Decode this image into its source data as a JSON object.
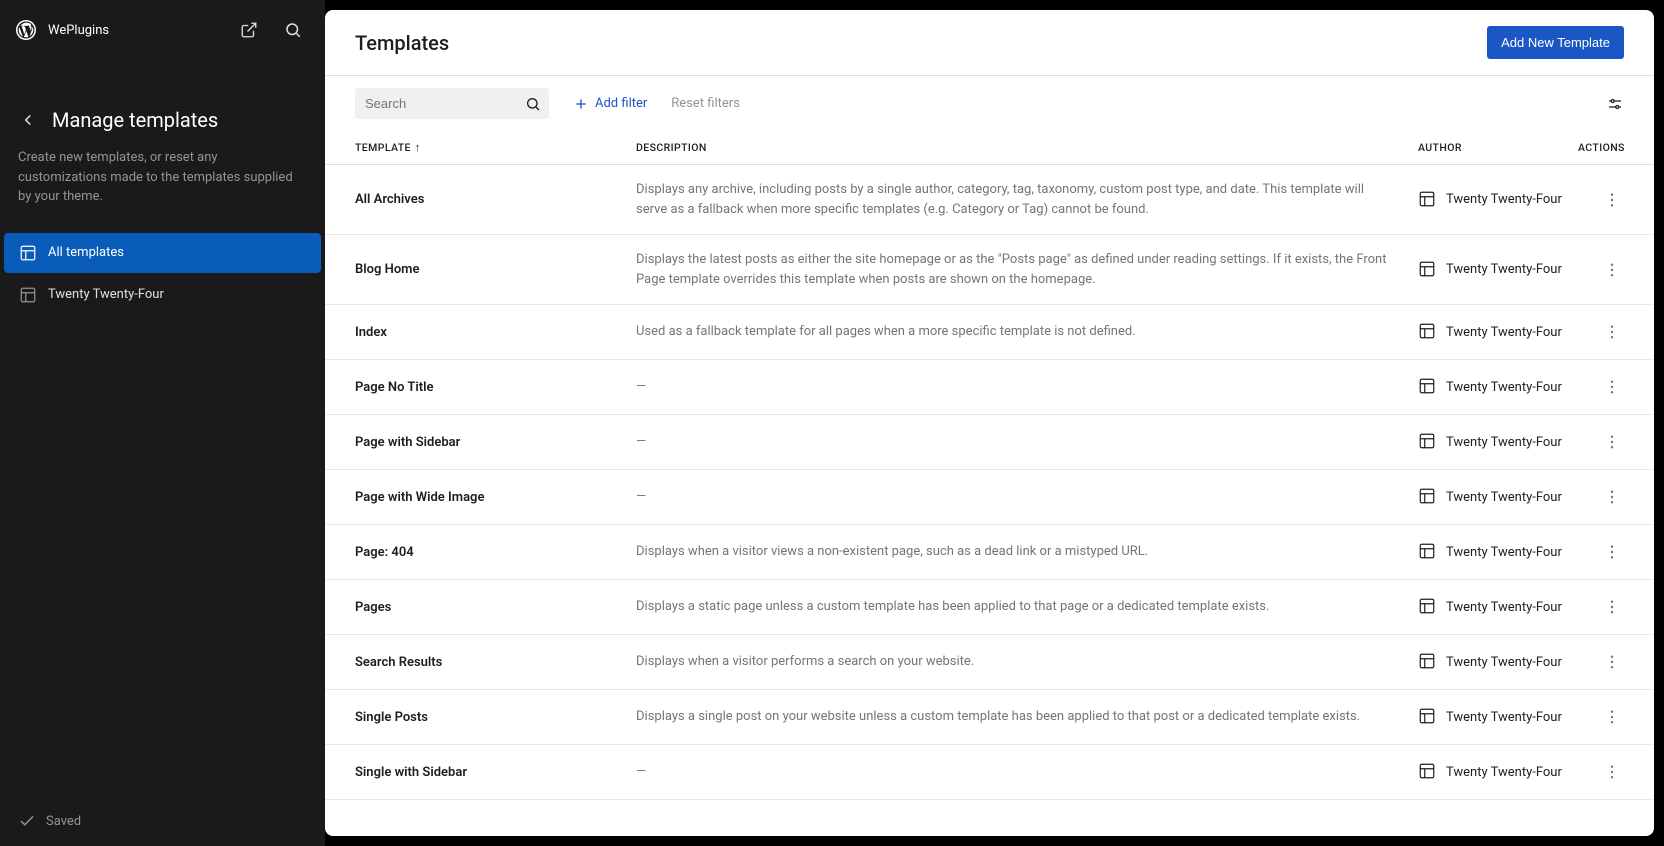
{
  "header": {
    "site_name": "WePlugins"
  },
  "sidebar": {
    "title": "Manage templates",
    "description": "Create new templates, or reset any customizations made to the templates supplied by your theme.",
    "nav": [
      {
        "label": "All templates",
        "active": true
      },
      {
        "label": "Twenty Twenty-Four",
        "active": false
      }
    ],
    "status": "Saved"
  },
  "main": {
    "title": "Templates",
    "add_button": "Add New Template",
    "search_placeholder": "Search",
    "add_filter": "Add filter",
    "reset_filters": "Reset filters",
    "columns": {
      "template": "TEMPLATE",
      "description": "DESCRIPTION",
      "author": "AUTHOR",
      "actions": "ACTIONS"
    },
    "rows": [
      {
        "name": "All Archives",
        "description": "Displays any archive, including posts by a single author, category, tag, taxonomy, custom post type, and date. This template will serve as a fallback when more specific templates (e.g. Category or Tag) cannot be found.",
        "author": "Twenty Twenty-Four"
      },
      {
        "name": "Blog Home",
        "description": "Displays the latest posts as either the site homepage or as the \"Posts page\" as defined under reading settings. If it exists, the Front Page template overrides this template when posts are shown on the homepage.",
        "author": "Twenty Twenty-Four"
      },
      {
        "name": "Index",
        "description": "Used as a fallback template for all pages when a more specific template is not defined.",
        "author": "Twenty Twenty-Four"
      },
      {
        "name": "Page No Title",
        "description": "—",
        "author": "Twenty Twenty-Four"
      },
      {
        "name": "Page with Sidebar",
        "description": "—",
        "author": "Twenty Twenty-Four"
      },
      {
        "name": "Page with Wide Image",
        "description": "—",
        "author": "Twenty Twenty-Four"
      },
      {
        "name": "Page: 404",
        "description": "Displays when a visitor views a non-existent page, such as a dead link or a mistyped URL.",
        "author": "Twenty Twenty-Four"
      },
      {
        "name": "Pages",
        "description": "Displays a static page unless a custom template has been applied to that page or a dedicated template exists.",
        "author": "Twenty Twenty-Four"
      },
      {
        "name": "Search Results",
        "description": "Displays when a visitor performs a search on your website.",
        "author": "Twenty Twenty-Four"
      },
      {
        "name": "Single Posts",
        "description": "Displays a single post on your website unless a custom template has been applied to that post or a dedicated template exists.",
        "author": "Twenty Twenty-Four"
      },
      {
        "name": "Single with Sidebar",
        "description": "—",
        "author": "Twenty Twenty-Four"
      }
    ]
  }
}
